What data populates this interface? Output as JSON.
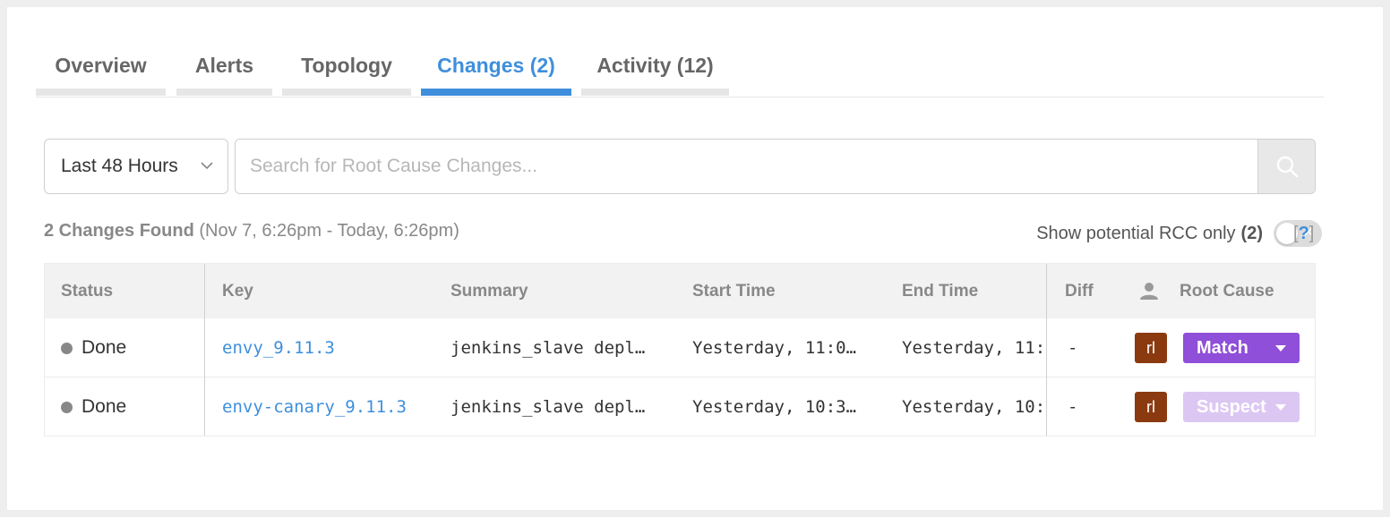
{
  "tabs": [
    {
      "label": "Overview",
      "active": false
    },
    {
      "label": "Alerts",
      "active": false
    },
    {
      "label": "Topology",
      "active": false
    },
    {
      "label": "Changes (2)",
      "active": true
    },
    {
      "label": "Activity (12)",
      "active": false
    }
  ],
  "filter": {
    "range_value": "Last 48 Hours",
    "search_placeholder": "Search for Root Cause Changes...",
    "search_value": ""
  },
  "summary": {
    "count_label": "2 Changes Found",
    "range_label": "(Nov 7, 6:26pm - Today, 6:26pm)",
    "rcc_label": "Show potential RCC only",
    "rcc_count": "(2)",
    "rcc_toggle_on": false,
    "help_label": "?"
  },
  "table": {
    "headers": {
      "status": "Status",
      "key": "Key",
      "summary": "Summary",
      "start": "Start Time",
      "end": "End Time",
      "diff": "Diff",
      "root_cause": "Root Cause"
    },
    "rows": [
      {
        "status": "Done",
        "key": "envy_9.11.3",
        "summary": "jenkins_slave depl…",
        "start": "Yesterday, 11:0…",
        "end": "Yesterday, 11:",
        "diff": "-",
        "avatar": "rl",
        "root_cause": "Match",
        "root_cause_color": "#8f4fd8"
      },
      {
        "status": "Done",
        "key": "envy-canary_9.11.3",
        "summary": "jenkins_slave depl…",
        "start": "Yesterday, 10:3…",
        "end": "Yesterday, 10:",
        "diff": "-",
        "avatar": "rl",
        "root_cause": "Suspect",
        "root_cause_color": "#dcc7f3"
      }
    ]
  },
  "colors": {
    "accent": "#3f8fdc",
    "avatar": "#8b3a0f",
    "match": "#8f4fd8",
    "suspect": "#dcc7f3"
  },
  "icons": {
    "search": "search-icon",
    "chevron": "chevron-down-icon",
    "user": "user-icon",
    "caret": "caret-down-icon",
    "toggle_x": "close-icon"
  }
}
